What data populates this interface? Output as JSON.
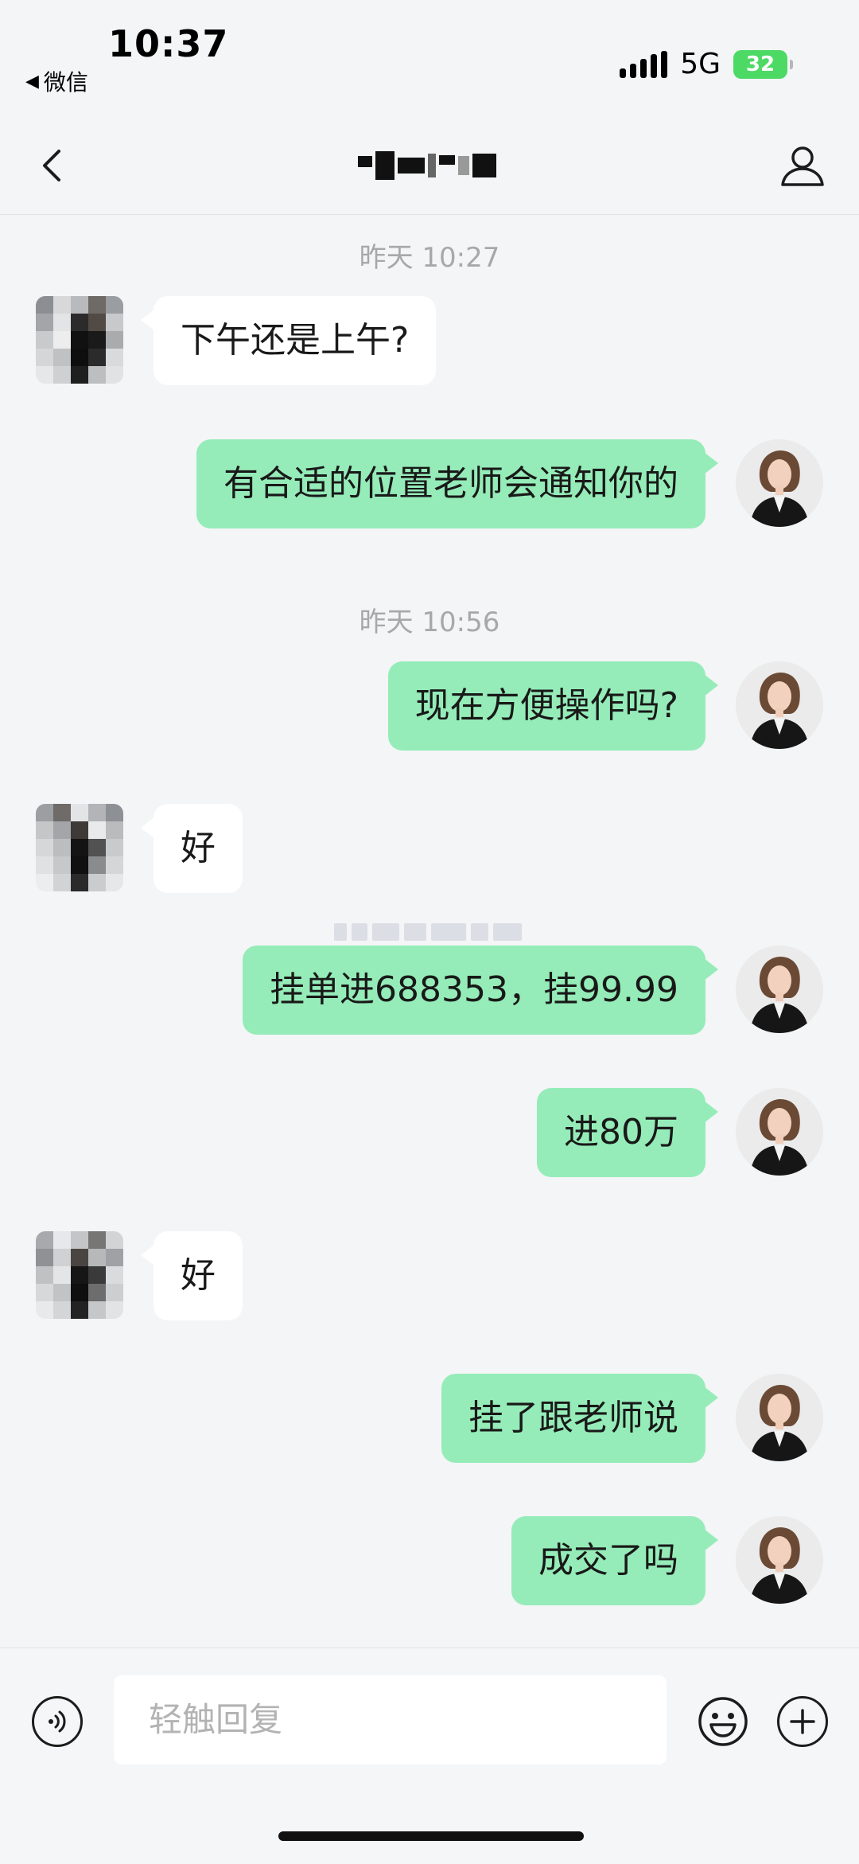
{
  "status_bar": {
    "time": "10:37",
    "back_app_label": "微信",
    "network": "5G",
    "battery_level": "32",
    "battery_color": "#4cd964"
  },
  "nav": {
    "back_icon": "chevron-left-icon",
    "title_redacted": true,
    "profile_icon": "person-icon"
  },
  "colors": {
    "outgoing_bubble": "#95ecb8",
    "incoming_bubble": "#ffffff",
    "background": "#f3f5f6"
  },
  "chat": {
    "timestamps": [
      "昨天 10:27",
      "昨天 10:56"
    ],
    "messages": [
      {
        "direction": "in",
        "text": "下午还是上午?"
      },
      {
        "direction": "out",
        "text": "有合适的位置老师会通知你的"
      },
      {
        "direction": "out",
        "text": "现在方便操作吗?"
      },
      {
        "direction": "in",
        "text": "好"
      },
      {
        "direction": "out",
        "text": "挂单进688353，挂99.99"
      },
      {
        "direction": "out",
        "text": "进80万"
      },
      {
        "direction": "in",
        "text": "好"
      },
      {
        "direction": "out",
        "text": "挂了跟老师说"
      },
      {
        "direction": "out",
        "text": "成交了吗"
      }
    ]
  },
  "input_bar": {
    "placeholder": "轻触回复",
    "voice_icon": "voice-icon",
    "emoji_icon": "emoji-icon",
    "plus_icon": "plus-icon"
  }
}
